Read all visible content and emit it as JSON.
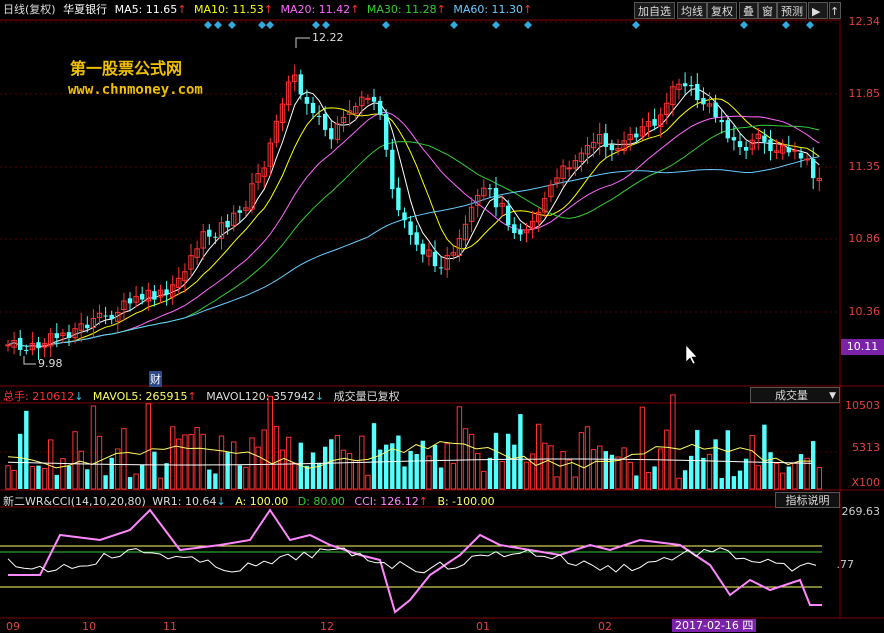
{
  "header": {
    "period": "日线(复权)",
    "stock": "华夏银行",
    "ma": [
      {
        "label": "MA5: 11.65",
        "color": "#ffffff"
      },
      {
        "label": "MA10: 11.53",
        "color": "#ffff00"
      },
      {
        "label": "MA20: 11.42",
        "color": "#ff66ff"
      },
      {
        "label": "MA30: 11.28",
        "color": "#33cc33"
      },
      {
        "label": "MA60: 11.30",
        "color": "#66ccff"
      }
    ],
    "buttons": [
      "加自选",
      "均线",
      "复权",
      "叠",
      "窗",
      "预测"
    ],
    "arrow_down": "↑"
  },
  "watermark": {
    "line1": "第一股票公式网",
    "line2": "www.chnmoney.com"
  },
  "price_axis": [
    "12.34",
    "11.85",
    "11.35",
    "10.86",
    "10.36"
  ],
  "current_price": "10.11",
  "annotations": {
    "high": "12.22",
    "low": "9.98",
    "cai": "财"
  },
  "volume_header": {
    "total_label": "总手: 210612",
    "mavol5": "MAVOL5: 265915",
    "mavol120": "MAVOL120: 357942",
    "note": "成交量已复权",
    "dropdown": "成交量"
  },
  "volume_axis": [
    "10503",
    "5313",
    "X100"
  ],
  "indicator_header": {
    "name": "新二WR&CCI(14,10,20,80)",
    "wr1": "WR1: 10.64",
    "a": "A: 100.00",
    "d": "D: 80.00",
    "cci": "CCI: 126.12",
    "b": "B: -100.00",
    "button": "指标说明"
  },
  "indicator_axis": [
    "269.63",
    ".77"
  ],
  "x_axis": [
    "09",
    "10",
    "11",
    "12",
    "01",
    "02"
  ],
  "date_badge": "2017-02-16 四",
  "colors": {
    "up": "#ff3232",
    "down": "#54ffff",
    "bg": "#000000",
    "grid": "#800000"
  }
}
